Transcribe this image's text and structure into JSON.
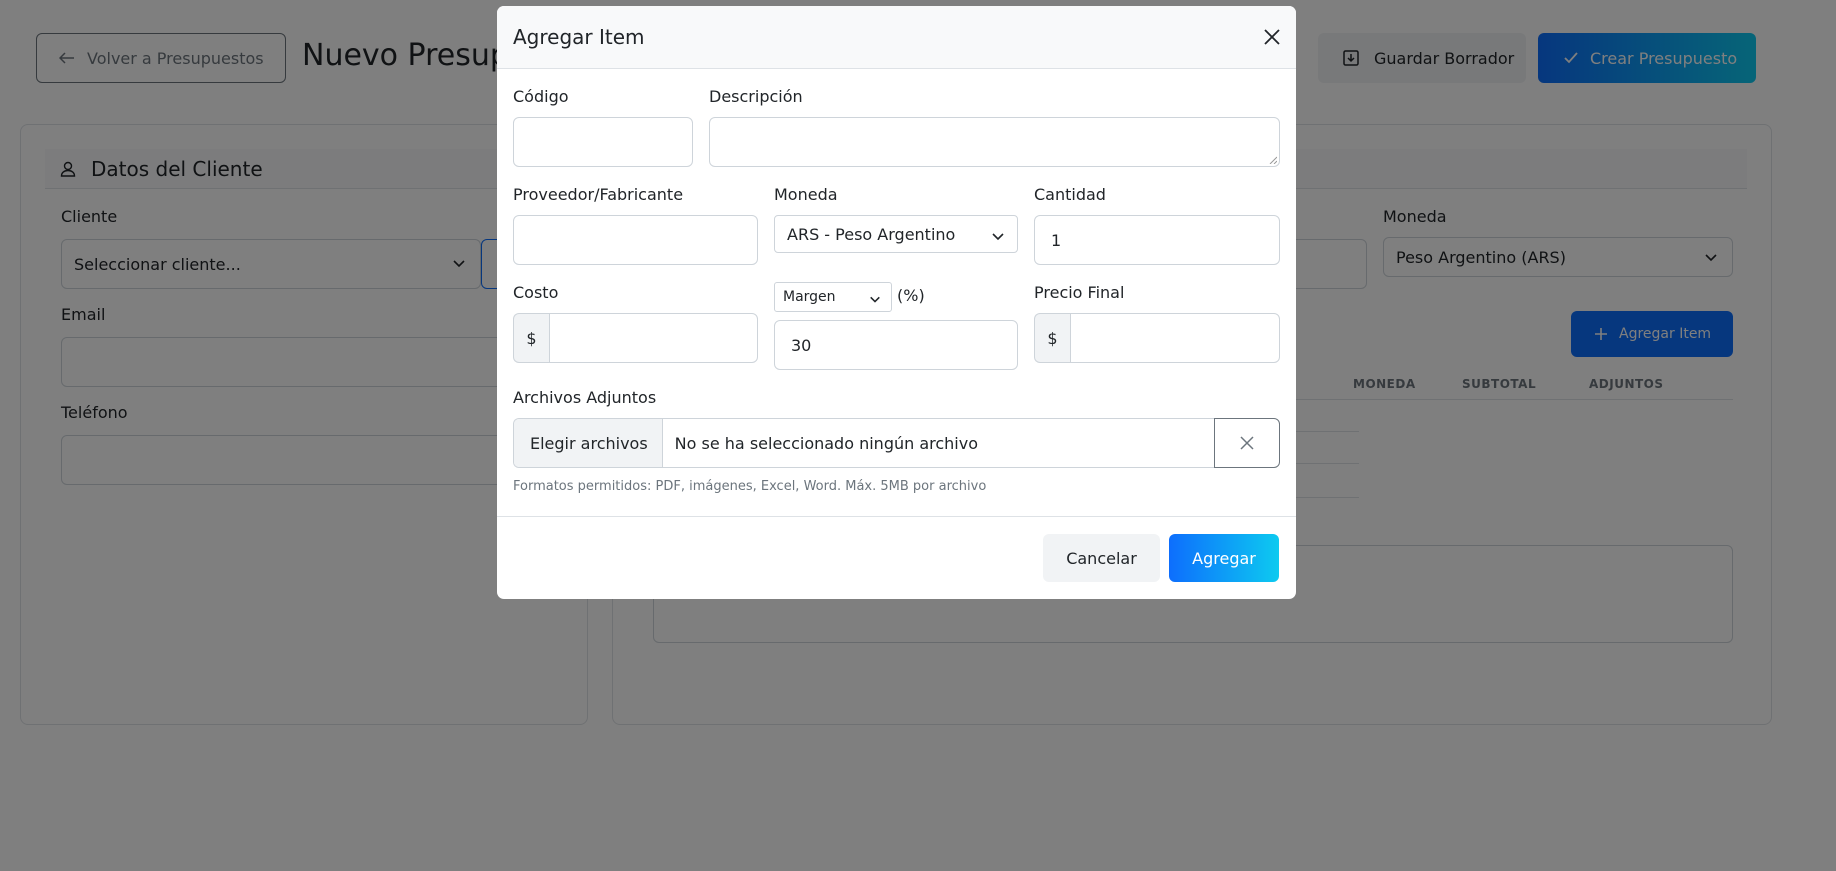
{
  "page": {
    "back_button": "Volver a Presupuestos",
    "title": "Nuevo Presupu",
    "draft_button": "Guardar Borrador",
    "create_button": "Crear Presupuesto",
    "client_card": {
      "header": "Datos del Cliente",
      "client_label": "Cliente",
      "client_placeholder": "Seleccionar cliente...",
      "email_label": "Email",
      "phone_label": "Teléfono"
    },
    "items_card": {
      "currency_label": "Moneda",
      "currency_value": "Peso Argentino (ARS)",
      "add_item_button": "Agregar Item",
      "columns": [
        "MONEDA",
        "SUBTOTAL",
        "ADJUNTOS"
      ]
    }
  },
  "modal": {
    "title": "Agregar Item",
    "codigo_label": "Código",
    "descripcion_label": "Descripción",
    "proveedor_label": "Proveedor/Fabricante",
    "moneda_label": "Moneda",
    "moneda_value": "ARS - Peso Argentino",
    "cantidad_label": "Cantidad",
    "cantidad_value": "1",
    "costo_label": "Costo",
    "currency_symbol": "$",
    "margin_select": "Margen",
    "pct_label": "(%)",
    "margin_value": "30",
    "precio_final_label": "Precio Final",
    "adjuntos_label": "Archivos Adjuntos",
    "file_button": "Elegir archivos",
    "file_status": "No se ha seleccionado ningún archivo",
    "help_text": "Formatos permitidos: PDF, imágenes, Excel, Word. Máx. 5MB por archivo",
    "cancel_button": "Cancelar",
    "add_button": "Agregar"
  },
  "icons": {
    "back": "arrow-left-icon",
    "draft": "save-icon",
    "create": "check-icon",
    "client": "user-icon",
    "add": "plus-icon",
    "close": "close-icon",
    "chevron": "chevron-down-icon"
  },
  "colors": {
    "primary": "#0d6efd",
    "gradient_end": "#0dcaf0",
    "overlay": "rgba(0,0,0,0.5)"
  }
}
